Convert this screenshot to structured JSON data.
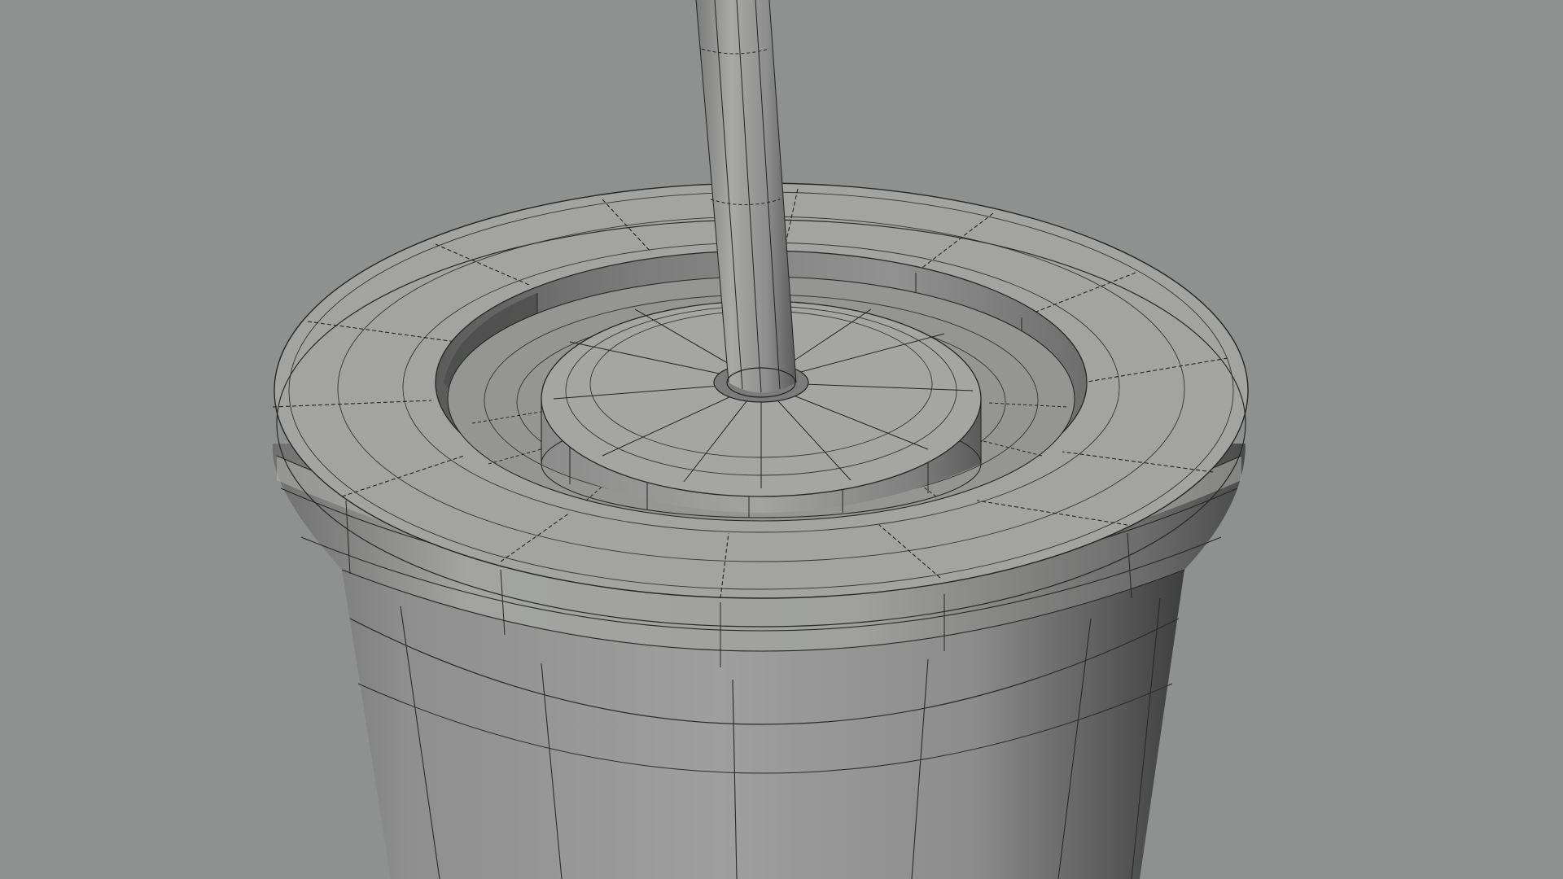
{
  "viewport": {
    "background_color": "#8f9190",
    "shading": "gray-clay",
    "overlay": "wireframe",
    "wire_color": "#1e1e1e"
  },
  "model": {
    "object": "cup-with-lid-and-straw",
    "parts": [
      "cup-body",
      "lid-rim",
      "lid-bead",
      "lid-inner-well",
      "lid-center-boss",
      "straw"
    ],
    "body_color": "#9c9d9c",
    "rim_top_color": "#a6a7a5",
    "shadow_color": "#4e4f4e"
  }
}
